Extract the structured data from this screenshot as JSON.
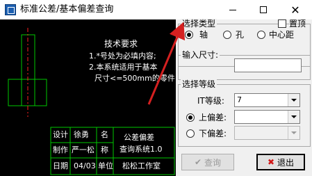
{
  "window": {
    "title": "标准公差/基本偏差查询",
    "close_glyph": "✕"
  },
  "drawing": {
    "notes_heading": "技术要求",
    "note_1": "1.*号处为必填内容;",
    "note_2": "2.本系统适用于基本",
    "note_3": "尺寸<=500mm的零件.",
    "title_block": {
      "design_label": "设计",
      "designer": "徐勇",
      "name_label": "名",
      "product_line1": "公差偏差",
      "make_label": "制作",
      "maker": "严一松",
      "name_label2": "称",
      "product_line2": "查询系统1.0",
      "date_label": "日期",
      "date": "04/03",
      "unit_label": "单位",
      "org": "松松工作室"
    }
  },
  "type_group": {
    "legend": "选择类型",
    "pin_label": "置顶",
    "options": [
      "轴",
      "孔",
      "中心距"
    ],
    "selected": "轴"
  },
  "size_group": {
    "legend": "输入尺寸:",
    "value": ""
  },
  "grade_group": {
    "legend": "选择等级",
    "it_label": "IT等级:",
    "it_value": "7",
    "upper_label": "上偏差:",
    "upper_value": "",
    "lower_label": "下偏差:",
    "lower_value": "",
    "selected": "upper"
  },
  "buttons": {
    "query": "查询",
    "exit": "退出"
  },
  "colors": {
    "drawing_bg": "#000000",
    "line_green": "#00c800",
    "center_red": "#ff2020",
    "annotation_arrow": "#d42020"
  }
}
